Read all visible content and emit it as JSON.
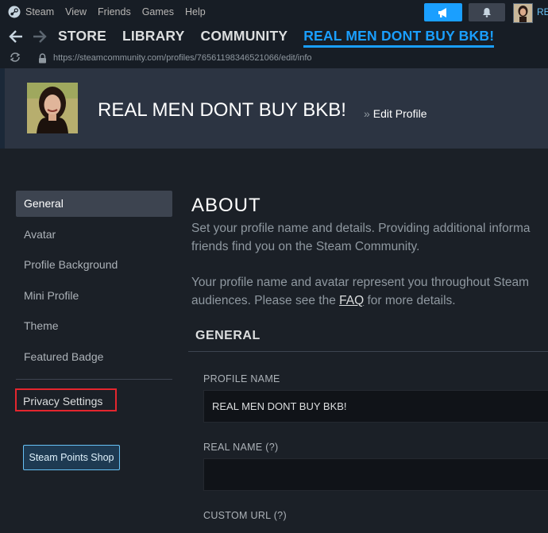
{
  "menubar": {
    "app_name": "Steam",
    "items": [
      "View",
      "Friends",
      "Games",
      "Help"
    ],
    "user_name": "RE"
  },
  "nav": {
    "tabs": [
      "STORE",
      "LIBRARY",
      "COMMUNITY",
      "REAL MEN DONT BUY BKB!"
    ],
    "active_tab": "REAL MEN DONT BUY BKB!"
  },
  "urlbar": {
    "url": "https://steamcommunity.com/profiles/76561198346521066/edit/info"
  },
  "profile": {
    "name": "REAL MEN DONT BUY BKB!",
    "breadcrumb_sep": "»",
    "breadcrumb": "Edit Profile"
  },
  "sidebar": {
    "items": [
      "General",
      "Avatar",
      "Profile Background",
      "Mini Profile",
      "Theme",
      "Featured Badge"
    ],
    "privacy": "Privacy Settings",
    "points_shop": "Steam Points Shop"
  },
  "about": {
    "title": "ABOUT",
    "line1": "Set your profile name and details. Providing additional informa",
    "line2": "friends find you on the Steam Community.",
    "line3": "Your profile name and avatar represent you throughout Steam",
    "line4_pre": "audiences. Please see the ",
    "faq": "FAQ",
    "line4_post": " for more details."
  },
  "general": {
    "header": "GENERAL",
    "profile_name_label": "PROFILE NAME",
    "profile_name_value": "REAL MEN DONT BUY BKB!",
    "real_name_label": "REAL NAME (?)",
    "real_name_value": "",
    "custom_url_label": "CUSTOM URL (?)"
  },
  "colors": {
    "accent": "#1a9fff",
    "highlight_box": "#e4262e"
  }
}
